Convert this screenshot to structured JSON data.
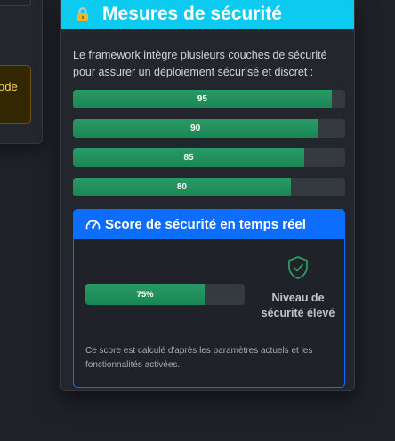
{
  "left_card": {
    "warning_text": "ode"
  },
  "security_card": {
    "title": "Mesures de sécurité",
    "header_icon": "lock-icon",
    "intro": "Le framework intègre plusieurs couches de sécurité pour assurer un déploiement sécurisé et discret :",
    "bars": [
      {
        "value": 95,
        "label": "95"
      },
      {
        "value": 90,
        "label": "90"
      },
      {
        "value": 85,
        "label": "85"
      },
      {
        "value": 80,
        "label": "80"
      }
    ]
  },
  "score_panel": {
    "icon": "gauge-icon",
    "title": "Score de sécurité en temps réel",
    "progress": {
      "value": 75,
      "label": "75%"
    },
    "level_icon": "shield-check-icon",
    "level_text": "Niveau de sécurité élevé",
    "note": "Ce score est calculé d'après les paramètres actuels et les fonctionnalités activées."
  },
  "colors": {
    "header_accent": "#0dcaf0",
    "score_accent": "#0d6efd",
    "success": "#198754",
    "warning": "#ffcf57"
  }
}
